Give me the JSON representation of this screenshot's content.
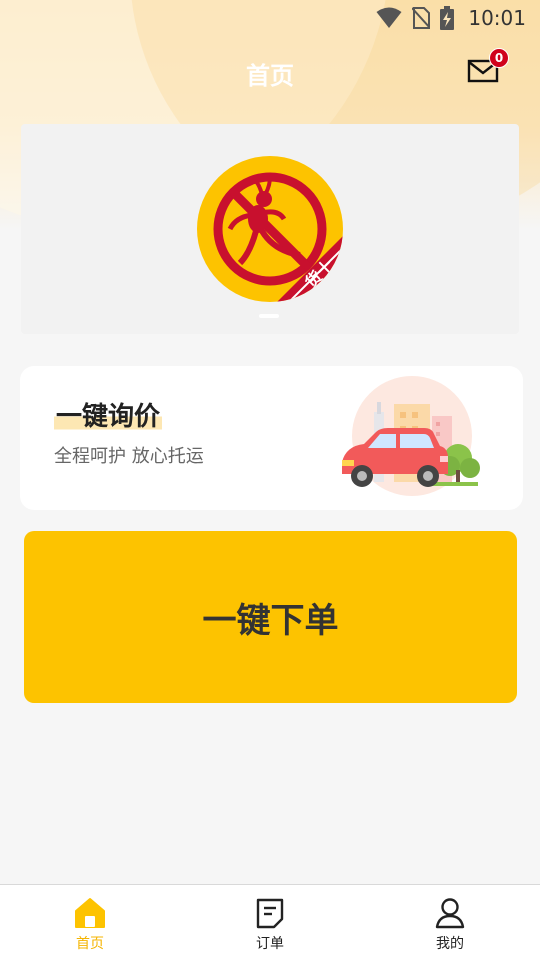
{
  "status_bar": {
    "time": "10:01",
    "icons": [
      "wifi-icon",
      "no-sim-icon",
      "battery-charging-icon"
    ]
  },
  "header": {
    "title": "首页",
    "mail_icon": "mail-icon",
    "unread_count": "0"
  },
  "banner": {
    "logo_icon": "ant-logo-icon",
    "logo_text": "货十",
    "page_count": 1,
    "active_page": 1
  },
  "inquiry_card": {
    "title": "一键询价",
    "subtitle": "全程呵护 放心托运",
    "illustration": "car-city-illustration"
  },
  "order_button": {
    "label": "一键下单"
  },
  "tabbar": {
    "items": [
      {
        "label": "首页",
        "icon": "home-icon",
        "active": true
      },
      {
        "label": "订单",
        "icon": "order-icon",
        "active": false
      },
      {
        "label": "我的",
        "icon": "profile-icon",
        "active": false
      }
    ]
  },
  "colors": {
    "accent": "#fdc300",
    "active_tab": "#f5b400",
    "badge": "#d0021b",
    "logo_red": "#c8102e"
  }
}
